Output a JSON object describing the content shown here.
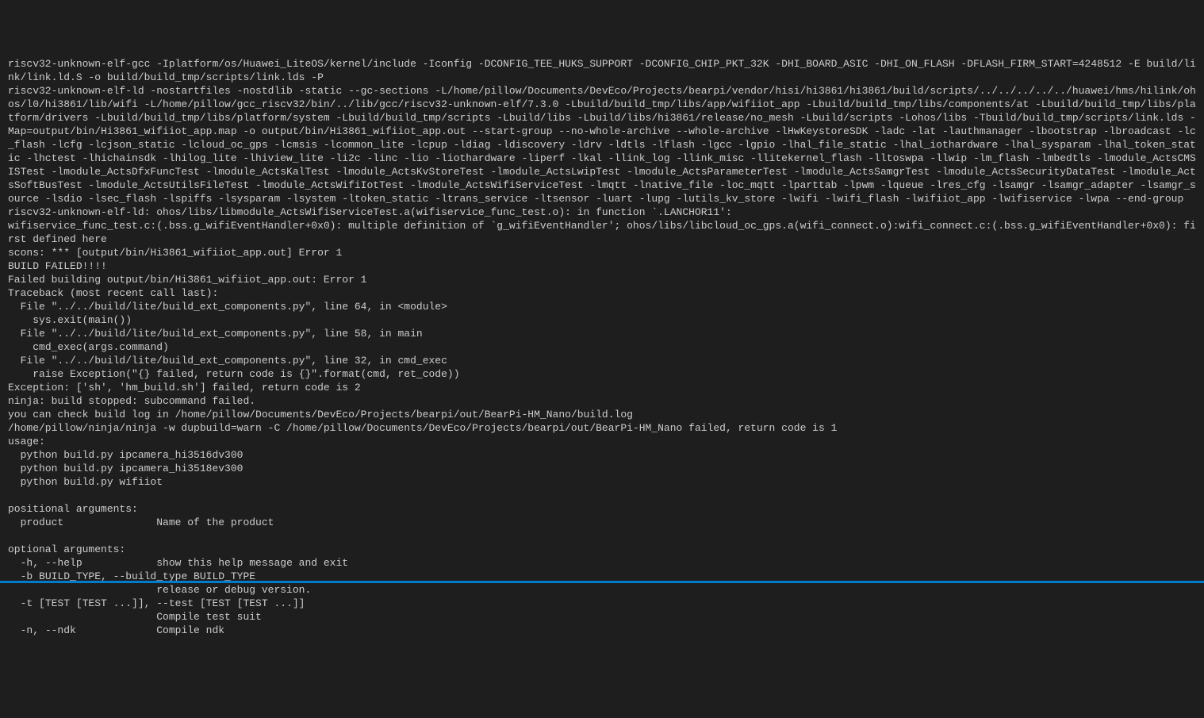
{
  "terminal": {
    "lines": [
      "riscv32-unknown-elf-gcc -Iplatform/os/Huawei_LiteOS/kernel/include -Iconfig -DCONFIG_TEE_HUKS_SUPPORT -DCONFIG_CHIP_PKT_32K -DHI_BOARD_ASIC -DHI_ON_FLASH -DFLASH_FIRM_START=4248512 -E build/link/link.ld.S -o build/build_tmp/scripts/link.lds -P",
      "riscv32-unknown-elf-ld -nostartfiles -nostdlib -static --gc-sections -L/home/pillow/Documents/DevEco/Projects/bearpi/vendor/hisi/hi3861/hi3861/build/scripts/../../../../../huawei/hms/hilink/ohos/l0/hi3861/lib/wifi -L/home/pillow/gcc_riscv32/bin/../lib/gcc/riscv32-unknown-elf/7.3.0 -Lbuild/build_tmp/libs/app/wifiiot_app -Lbuild/build_tmp/libs/components/at -Lbuild/build_tmp/libs/platform/drivers -Lbuild/build_tmp/libs/platform/system -Lbuild/build_tmp/scripts -Lbuild/libs -Lbuild/libs/hi3861/release/no_mesh -Lbuild/scripts -Lohos/libs -Tbuild/build_tmp/scripts/link.lds -Map=output/bin/Hi3861_wifiiot_app.map -o output/bin/Hi3861_wifiiot_app.out --start-group --no-whole-archive --whole-archive -lHwKeystoreSDK -ladc -lat -lauthmanager -lbootstrap -lbroadcast -lc_flash -lcfg -lcjson_static -lcloud_oc_gps -lcmsis -lcommon_lite -lcpup -ldiag -ldiscovery -ldrv -ldtls -lflash -lgcc -lgpio -lhal_file_static -lhal_iothardware -lhal_sysparam -lhal_token_static -lhctest -lhichainsdk -lhilog_lite -lhiview_lite -li2c -linc -lio -liothardware -liperf -lkal -llink_log -llink_misc -llitekernel_flash -lltoswpa -llwip -lm_flash -lmbedtls -lmodule_ActsCMSISTest -lmodule_ActsDfxFuncTest -lmodule_ActsKalTest -lmodule_ActsKvStoreTest -lmodule_ActsLwipTest -lmodule_ActsParameterTest -lmodule_ActsSamgrTest -lmodule_ActsSecurityDataTest -lmodule_ActsSoftBusTest -lmodule_ActsUtilsFileTest -lmodule_ActsWifiIotTest -lmodule_ActsWifiServiceTest -lmqtt -lnative_file -loc_mqtt -lparttab -lpwm -lqueue -lres_cfg -lsamgr -lsamgr_adapter -lsamgr_source -lsdio -lsec_flash -lspiffs -lsysparam -lsystem -ltoken_static -ltrans_service -ltsensor -luart -lupg -lutils_kv_store -lwifi -lwifi_flash -lwifiiot_app -lwifiservice -lwpa --end-group",
      "riscv32-unknown-elf-ld: ohos/libs/libmodule_ActsWifiServiceTest.a(wifiservice_func_test.o): in function `.LANCHOR11':",
      "wifiservice_func_test.c:(.bss.g_wifiEventHandler+0x0): multiple definition of `g_wifiEventHandler'; ohos/libs/libcloud_oc_gps.a(wifi_connect.o):wifi_connect.c:(.bss.g_wifiEventHandler+0x0): first defined here",
      "scons: *** [output/bin/Hi3861_wifiiot_app.out] Error 1",
      "BUILD FAILED!!!!",
      "Failed building output/bin/Hi3861_wifiiot_app.out: Error 1",
      "Traceback (most recent call last):",
      "  File \"../../build/lite/build_ext_components.py\", line 64, in <module>",
      "    sys.exit(main())",
      "  File \"../../build/lite/build_ext_components.py\", line 58, in main",
      "    cmd_exec(args.command)",
      "  File \"../../build/lite/build_ext_components.py\", line 32, in cmd_exec",
      "    raise Exception(\"{} failed, return code is {}\".format(cmd, ret_code))",
      "Exception: ['sh', 'hm_build.sh'] failed, return code is 2",
      "ninja: build stopped: subcommand failed.",
      "you can check build log in /home/pillow/Documents/DevEco/Projects/bearpi/out/BearPi-HM_Nano/build.log",
      "/home/pillow/ninja/ninja -w dupbuild=warn -C /home/pillow/Documents/DevEco/Projects/bearpi/out/BearPi-HM_Nano failed, return code is 1",
      "usage:",
      "  python build.py ipcamera_hi3516dv300",
      "  python build.py ipcamera_hi3518ev300",
      "  python build.py wifiiot",
      "",
      "positional arguments:",
      "  product               Name of the product",
      "",
      "optional arguments:",
      "  -h, --help            show this help message and exit",
      "  -b BUILD_TYPE, --build_type BUILD_TYPE",
      "                        release or debug version.",
      "  -t [TEST [TEST ...]], --test [TEST [TEST ...]]",
      "                        Compile test suit",
      "  -n, --ndk             Compile ndk"
    ]
  }
}
